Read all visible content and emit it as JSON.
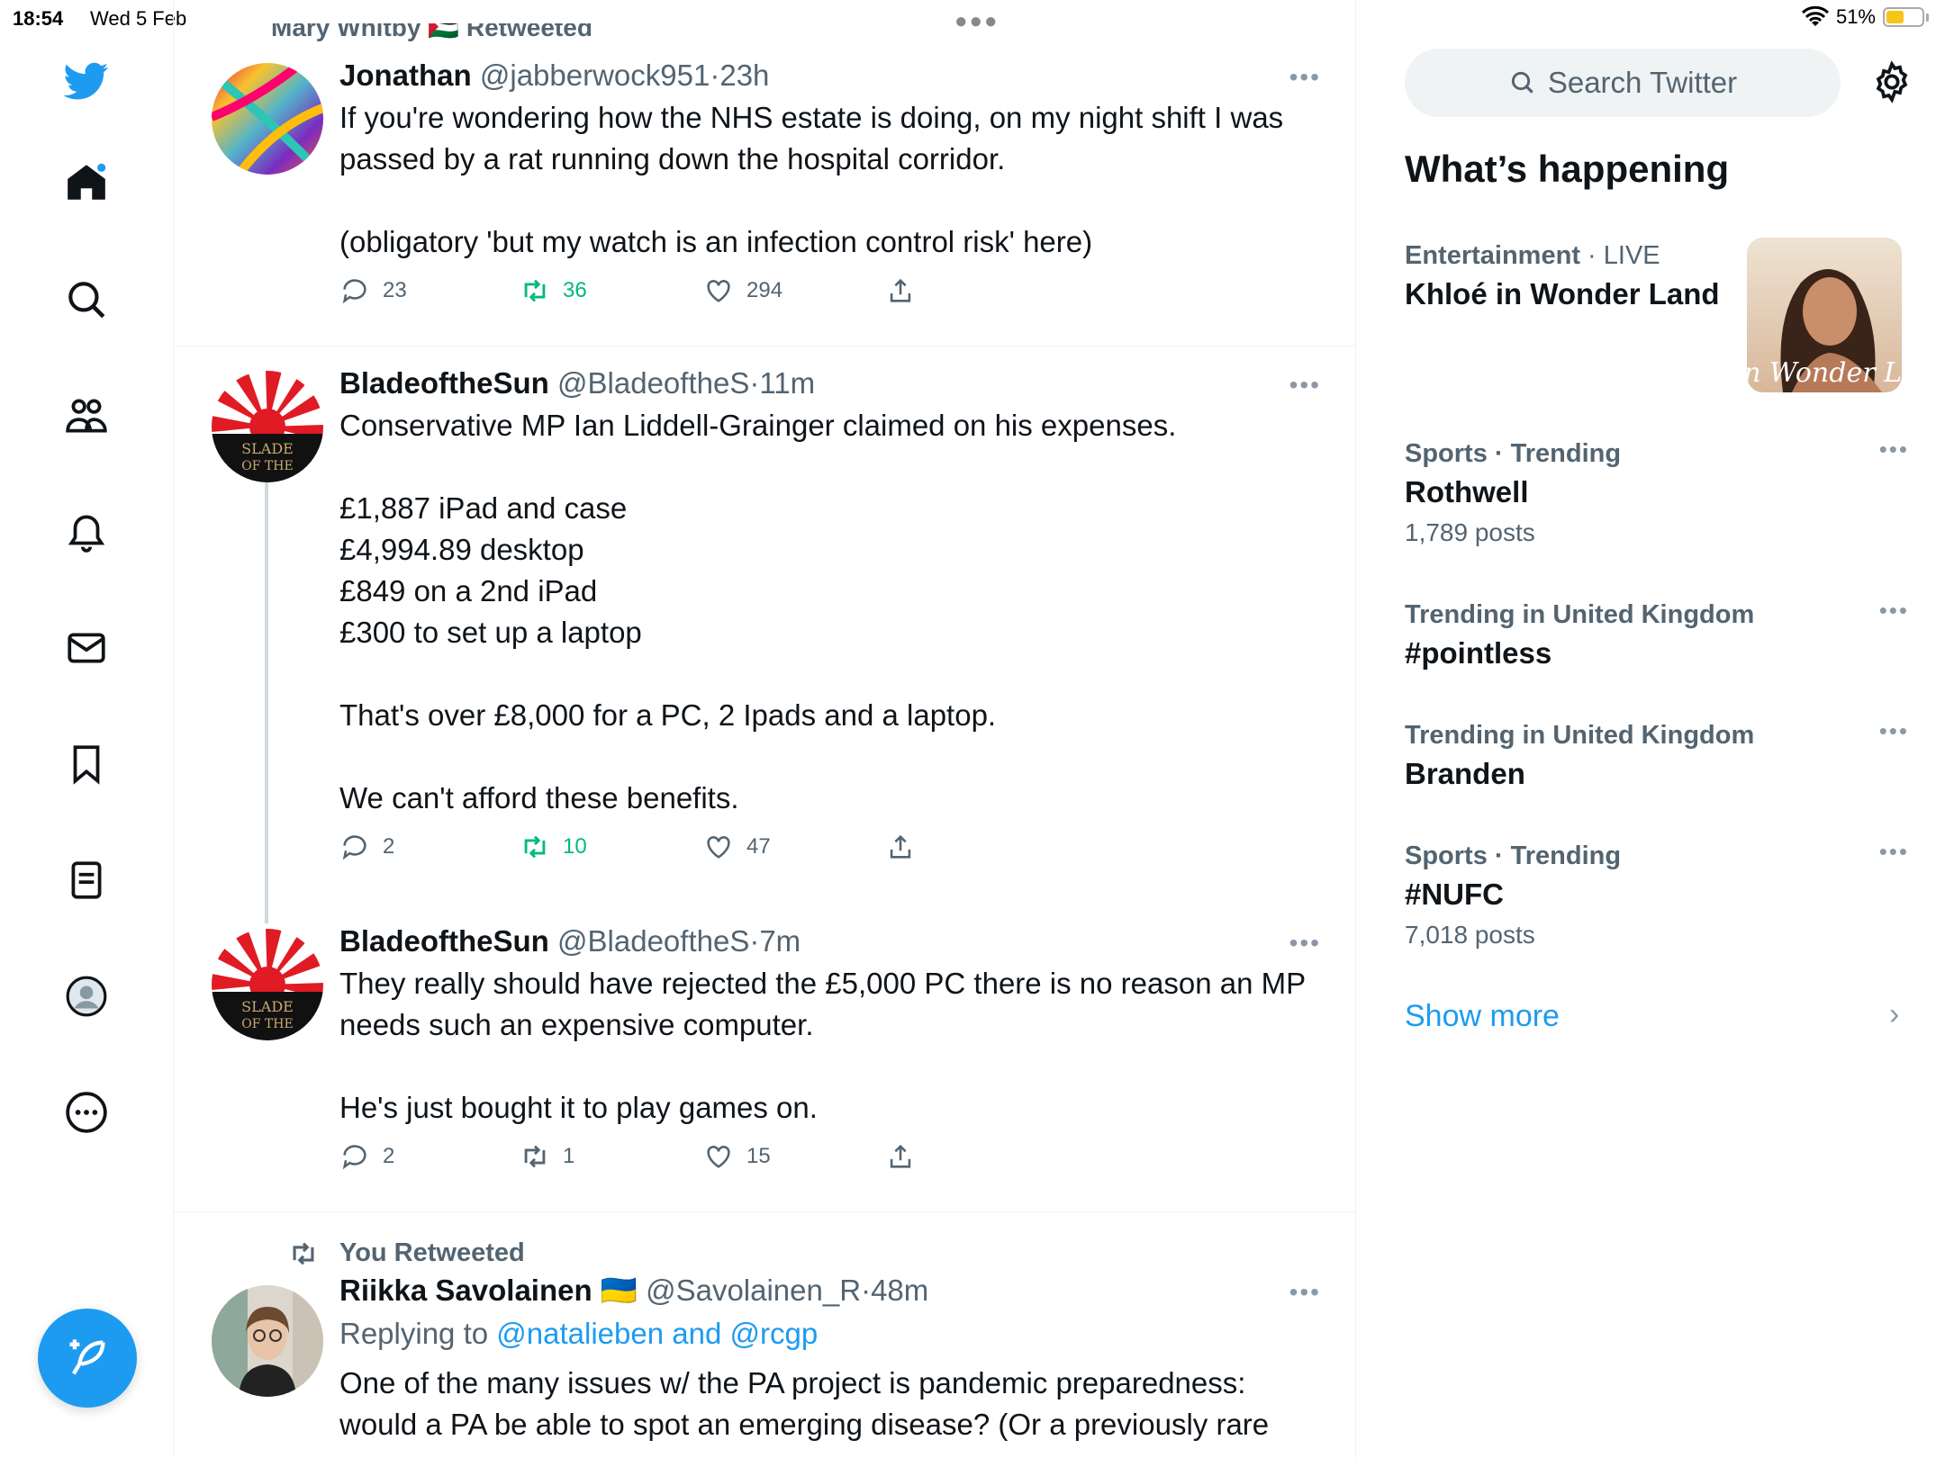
{
  "status_bar": {
    "time": "18:54",
    "date": "Wed 5 Feb",
    "battery": "51%",
    "battery_level": 0.51
  },
  "nav": {
    "items": [
      "twitter-logo",
      "home",
      "search",
      "communities",
      "notifications",
      "messages",
      "bookmarks",
      "lists",
      "profile",
      "more"
    ],
    "compose_label": "Tweet"
  },
  "feed": {
    "top_retweet_label": "Mary Whitby 🇵🇸 Retweeted",
    "tweets": [
      {
        "name": "Jonathan",
        "handle": "@jabberwock951",
        "dot": "·",
        "time": "23h",
        "text": "If you're wondering how the NHS estate is doing, on my night shift I was passed by a rat running down the hospital corridor.\n\n(obligatory 'but my watch is an infection control risk' here)",
        "replies": "23",
        "retweets": "36",
        "likes": "294"
      },
      {
        "name": "BladeoftheSun",
        "handle": "@BladeoftheS",
        "dot": "·",
        "time": "11m",
        "text": "Conservative MP Ian Liddell-Grainger claimed on his expenses.\n\n£1,887 iPad and case\n£4,994.89 desktop\n£849 on a 2nd iPad\n£300 to set up a laptop\n\nThat's over £8,000 for a PC, 2 Ipads and a laptop.\n\nWe can't afford these benefits.",
        "replies": "2",
        "retweets": "10",
        "likes": "47"
      },
      {
        "name": "BladeoftheSun",
        "handle": "@BladeoftheS",
        "dot": "·",
        "time": "7m",
        "text": "They really should have rejected the £5,000 PC there is no reason an MP needs such an expensive computer.\n\nHe's just bought it to play games on.",
        "replies": "2",
        "retweets": "1",
        "likes": "15"
      },
      {
        "retweet_label": "You Retweeted",
        "name": "Riikka Savolainen",
        "flag": "🇺🇦",
        "handle": "@Savolainen_R",
        "dot": "·",
        "time": "48m",
        "replying_prefix": "Replying to",
        "replying_to": "@natalieben and @rcgp",
        "text": "One of the many issues w/ the PA project is pandemic preparedness:\nwould a PA be able to spot an emerging disease? (Or a previously rare"
      }
    ]
  },
  "sidebar": {
    "search_placeholder": "Search Twitter",
    "heading": "What’s happening",
    "trends": [
      {
        "category": "Entertainment",
        "sep": "·",
        "status": "LIVE",
        "name": "Khloé in Wonder Land",
        "image_text": "é in Wonder L"
      },
      {
        "category": "Sports · Trending",
        "name": "Rothwell",
        "count": "1,789 posts"
      },
      {
        "category": "Trending in United Kingdom",
        "name": "#pointless"
      },
      {
        "category": "Trending in United Kingdom",
        "name": "Branden"
      },
      {
        "category": "Sports · Trending",
        "name": "#NUFC",
        "count": "7,018 posts"
      }
    ],
    "show_more": "Show more"
  },
  "colors": {
    "accent": "#1d9bf0",
    "retweet_green": "#00ba7c",
    "secondary_text": "#536471"
  }
}
